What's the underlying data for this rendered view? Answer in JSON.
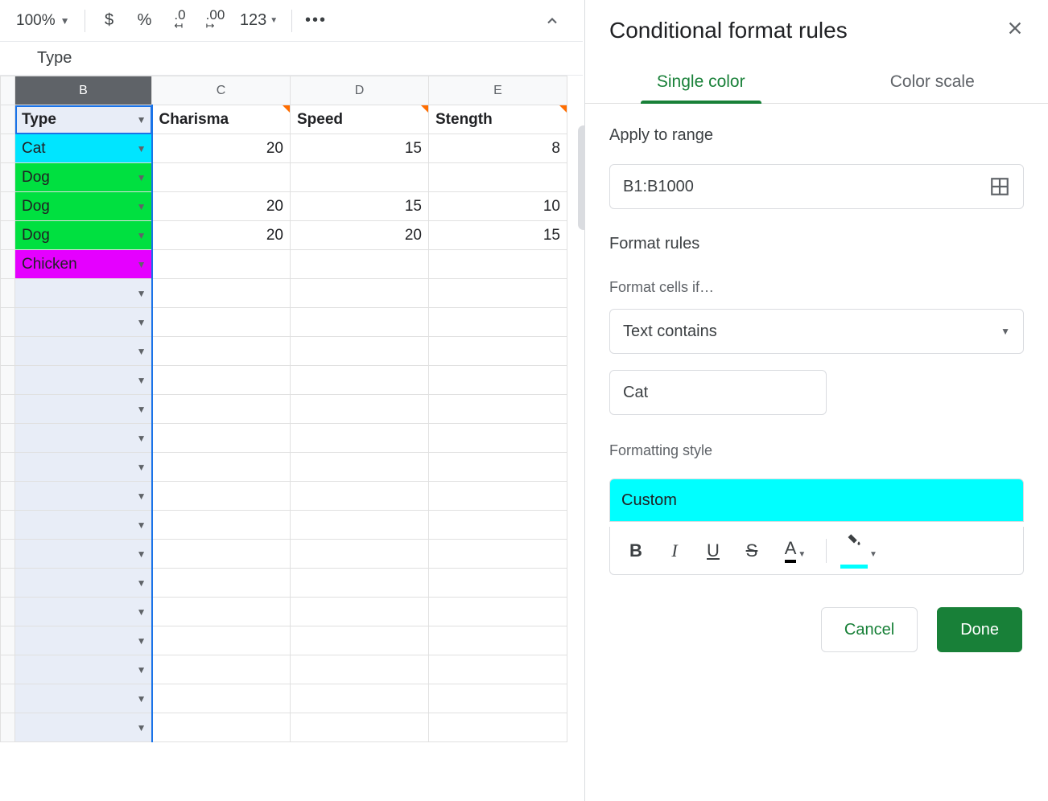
{
  "toolbar": {
    "zoom": "100%",
    "fmt_123": "123"
  },
  "formula_bar": {
    "value": "Type"
  },
  "columns": [
    "B",
    "C",
    "D",
    "E"
  ],
  "grid": {
    "headers": {
      "B": "Type",
      "C": "Charisma",
      "D": "Speed",
      "E": "Stength"
    },
    "rows": [
      {
        "B": "Cat",
        "C": "20",
        "D": "15",
        "E": "8",
        "bcolor": "#00e5ff"
      },
      {
        "B": "Dog",
        "C": "",
        "D": "",
        "E": "",
        "bcolor": "#00e040"
      },
      {
        "B": "Dog",
        "C": "20",
        "D": "15",
        "E": "10",
        "bcolor": "#00e040"
      },
      {
        "B": "Dog",
        "C": "20",
        "D": "20",
        "E": "15",
        "bcolor": "#00e040"
      },
      {
        "B": "Chicken",
        "C": "",
        "D": "",
        "E": "",
        "bcolor": "#e500ff"
      }
    ],
    "empty_rows": 16
  },
  "panel": {
    "title": "Conditional format rules",
    "tabs": {
      "single": "Single color",
      "scale": "Color scale"
    },
    "section_range": "Apply to range",
    "range_value": "B1:B1000",
    "section_rules": "Format rules",
    "sub_condition": "Format cells if…",
    "condition_value": "Text contains",
    "condition_input": "Cat",
    "sub_style": "Formatting style",
    "style_name": "Custom",
    "style_color": "#00ffff",
    "actions": {
      "cancel": "Cancel",
      "done": "Done"
    }
  }
}
